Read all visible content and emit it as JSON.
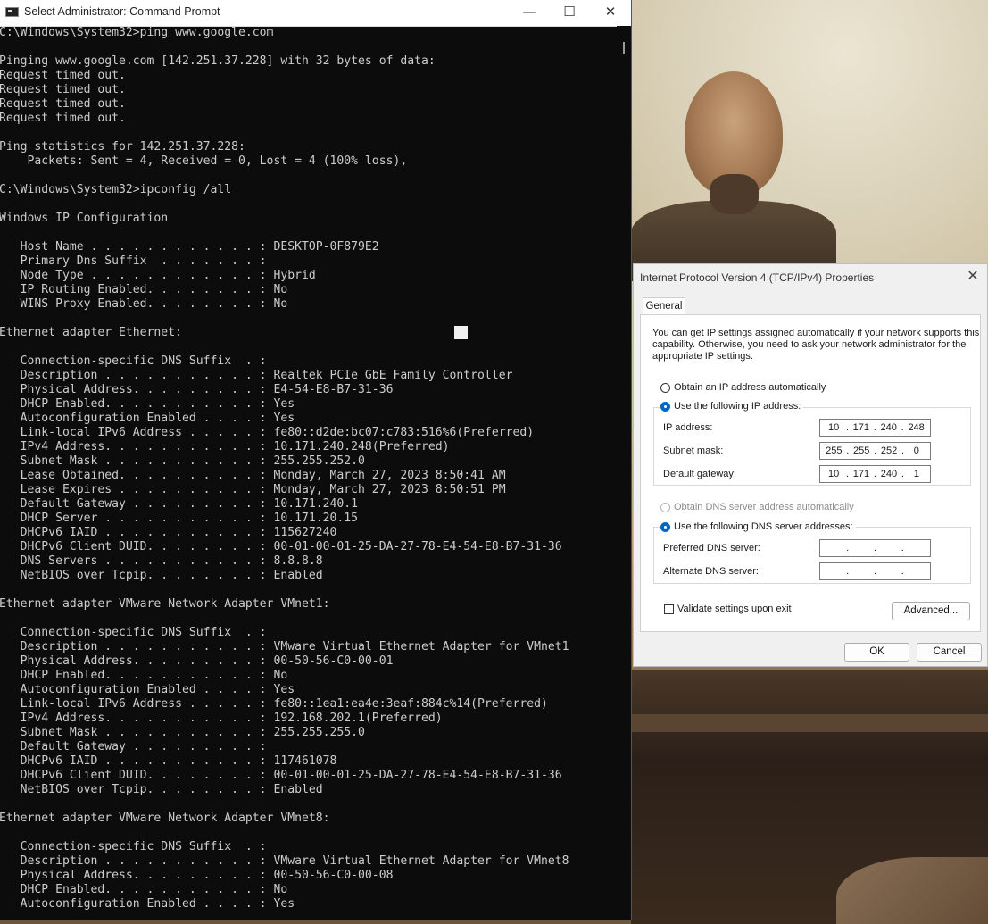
{
  "cmd": {
    "title": "Select Administrator: Command Prompt",
    "controls": {
      "minimize": "—",
      "maximize": "☐",
      "close": "✕"
    },
    "lines": [
      "C:\\Windows\\System32>ping www.google.com",
      "",
      "Pinging www.google.com [142.251.37.228] with 32 bytes of data:",
      "Request timed out.",
      "Request timed out.",
      "Request timed out.",
      "Request timed out.",
      "",
      "Ping statistics for 142.251.37.228:",
      "    Packets: Sent = 4, Received = 0, Lost = 4 (100% loss),",
      "",
      "C:\\Windows\\System32>ipconfig /all",
      "",
      "Windows IP Configuration",
      "",
      "   Host Name . . . . . . . . . . . . : DESKTOP-0F879E2",
      "   Primary Dns Suffix  . . . . . . . :",
      "   Node Type . . . . . . . . . . . . : Hybrid",
      "   IP Routing Enabled. . . . . . . . : No",
      "   WINS Proxy Enabled. . . . . . . . : No",
      "",
      "Ethernet adapter Ethernet:",
      "",
      "   Connection-specific DNS Suffix  . :",
      "   Description . . . . . . . . . . . : Realtek PCIe GbE Family Controller",
      "   Physical Address. . . . . . . . . : E4-54-E8-B7-31-36",
      "   DHCP Enabled. . . . . . . . . . . : Yes",
      "   Autoconfiguration Enabled . . . . : Yes",
      "   Link-local IPv6 Address . . . . . : fe80::d2de:bc07:c783:516%6(Preferred)",
      "   IPv4 Address. . . . . . . . . . . : 10.171.240.248(Preferred)",
      "   Subnet Mask . . . . . . . . . . . : 255.255.252.0",
      "   Lease Obtained. . . . . . . . . . : Monday, March 27, 2023 8:50:41 AM",
      "   Lease Expires . . . . . . . . . . : Monday, March 27, 2023 8:50:51 PM",
      "   Default Gateway . . . . . . . . . : 10.171.240.1",
      "   DHCP Server . . . . . . . . . . . : 10.171.20.15",
      "   DHCPv6 IAID . . . . . . . . . . . : 115627240",
      "   DHCPv6 Client DUID. . . . . . . . : 00-01-00-01-25-DA-27-78-E4-54-E8-B7-31-36",
      "   DNS Servers . . . . . . . . . . . : 8.8.8.8",
      "   NetBIOS over Tcpip. . . . . . . . : Enabled",
      "",
      "Ethernet adapter VMware Network Adapter VMnet1:",
      "",
      "   Connection-specific DNS Suffix  . :",
      "   Description . . . . . . . . . . . : VMware Virtual Ethernet Adapter for VMnet1",
      "   Physical Address. . . . . . . . . : 00-50-56-C0-00-01",
      "   DHCP Enabled. . . . . . . . . . . : No",
      "   Autoconfiguration Enabled . . . . : Yes",
      "   Link-local IPv6 Address . . . . . : fe80::1ea1:ea4e:3eaf:884c%14(Preferred)",
      "   IPv4 Address. . . . . . . . . . . : 192.168.202.1(Preferred)",
      "   Subnet Mask . . . . . . . . . . . : 255.255.255.0",
      "   Default Gateway . . . . . . . . . :",
      "   DHCPv6 IAID . . . . . . . . . . . : 117461078",
      "   DHCPv6 Client DUID. . . . . . . . : 00-01-00-01-25-DA-27-78-E4-54-E8-B7-31-36",
      "   NetBIOS over Tcpip. . . . . . . . : Enabled",
      "",
      "Ethernet adapter VMware Network Adapter VMnet8:",
      "",
      "   Connection-specific DNS Suffix  . :",
      "   Description . . . . . . . . . . . : VMware Virtual Ethernet Adapter for VMnet8",
      "   Physical Address. . . . . . . . . : 00-50-56-C0-00-08",
      "   DHCP Enabled. . . . . . . . . . . : No",
      "   Autoconfiguration Enabled . . . . : Yes"
    ]
  },
  "dialog": {
    "title": "Internet Protocol Version 4 (TCP/IPv4) Properties",
    "close": "✕",
    "tab": "General",
    "intro": "You can get IP settings assigned automatically if your network supports this capability. Otherwise, you need to ask your network administrator for the appropriate IP settings.",
    "ip_auto": "Obtain an IP address automatically",
    "ip_manual": "Use the following IP address:",
    "ip_address_label": "IP address:",
    "ip_address": [
      "10",
      "171",
      "240",
      "248"
    ],
    "subnet_label": "Subnet mask:",
    "subnet": [
      "255",
      "255",
      "252",
      "0"
    ],
    "gateway_label": "Default gateway:",
    "gateway": [
      "10",
      "171",
      "240",
      "1"
    ],
    "dns_auto": "Obtain DNS server address automatically",
    "dns_manual": "Use the following DNS server addresses:",
    "preferred_dns_label": "Preferred DNS server:",
    "alternate_dns_label": "Alternate DNS server:",
    "validate": "Validate settings upon exit",
    "advanced": "Advanced...",
    "ok": "OK",
    "cancel": "Cancel",
    "ip_mode": "manual",
    "dns_mode": "manual",
    "validate_checked": false
  }
}
